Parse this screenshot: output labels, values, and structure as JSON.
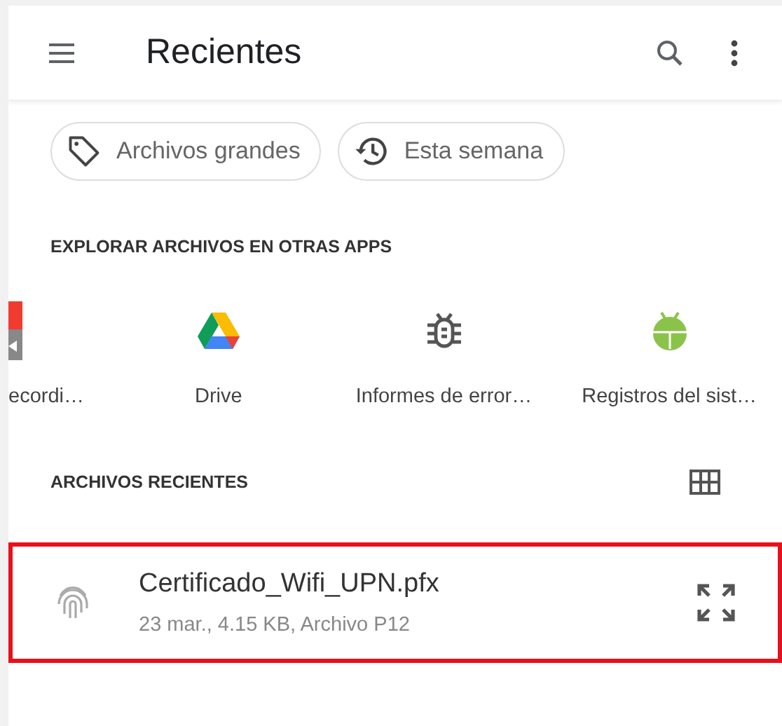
{
  "app_bar": {
    "title": "Recientes"
  },
  "chips": [
    {
      "label": "Archivos grandes",
      "kind": "tag"
    },
    {
      "label": "Esta semana",
      "kind": "history"
    }
  ],
  "apps_section": {
    "title": "EXPLORAR ARCHIVOS EN OTRAS APPS",
    "apps": [
      {
        "label": "ecordi…",
        "kind": "recorder"
      },
      {
        "label": "Drive",
        "kind": "drive"
      },
      {
        "label": "Informes de error…",
        "kind": "bug"
      },
      {
        "label": "Registros del sist…",
        "kind": "android"
      }
    ]
  },
  "recent_section": {
    "title": "ARCHIVOS RECIENTES",
    "files": [
      {
        "name": "Certificado_Wifi_UPN.pfx",
        "details": "23 mar., 4.15 KB, Archivo P12",
        "highlighted": true
      }
    ]
  }
}
